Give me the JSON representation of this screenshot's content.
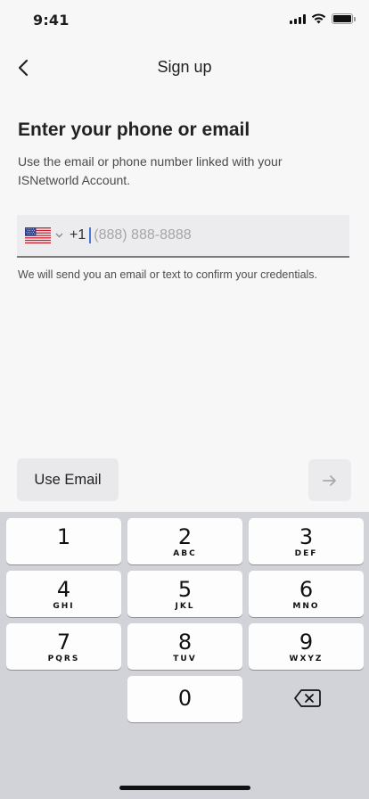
{
  "status_bar": {
    "time": "9:41",
    "icons": [
      "cellular-signal-icon",
      "wifi-icon",
      "battery-icon"
    ]
  },
  "nav": {
    "back_icon": "chevron-left-icon",
    "title": "Sign up"
  },
  "content": {
    "heading": "Enter your phone or email",
    "subtext": "Use the email or phone number linked with your ISNetworld Account.",
    "phone_field": {
      "country_flag": "us-flag-icon",
      "dial_code": "+1",
      "value": "",
      "placeholder": "(888) 888-8888"
    },
    "helper_text": "We will send you an email or text to confirm your credentials."
  },
  "actions": {
    "use_email_label": "Use Email",
    "next_icon": "arrow-right-icon"
  },
  "keyboard": {
    "keys": [
      {
        "digit": "1",
        "letters": ""
      },
      {
        "digit": "2",
        "letters": "ABC"
      },
      {
        "digit": "3",
        "letters": "DEF"
      },
      {
        "digit": "4",
        "letters": "GHI"
      },
      {
        "digit": "5",
        "letters": "JKL"
      },
      {
        "digit": "6",
        "letters": "MNO"
      },
      {
        "digit": "7",
        "letters": "PQRS"
      },
      {
        "digit": "8",
        "letters": "TUV"
      },
      {
        "digit": "9",
        "letters": "WXYZ"
      },
      {
        "digit": "0",
        "letters": ""
      }
    ],
    "delete_icon": "backspace-icon"
  },
  "colors": {
    "background": "#f7f7f8",
    "caret": "#4a78d6",
    "keyboard_bg": "#d1d3d9"
  }
}
